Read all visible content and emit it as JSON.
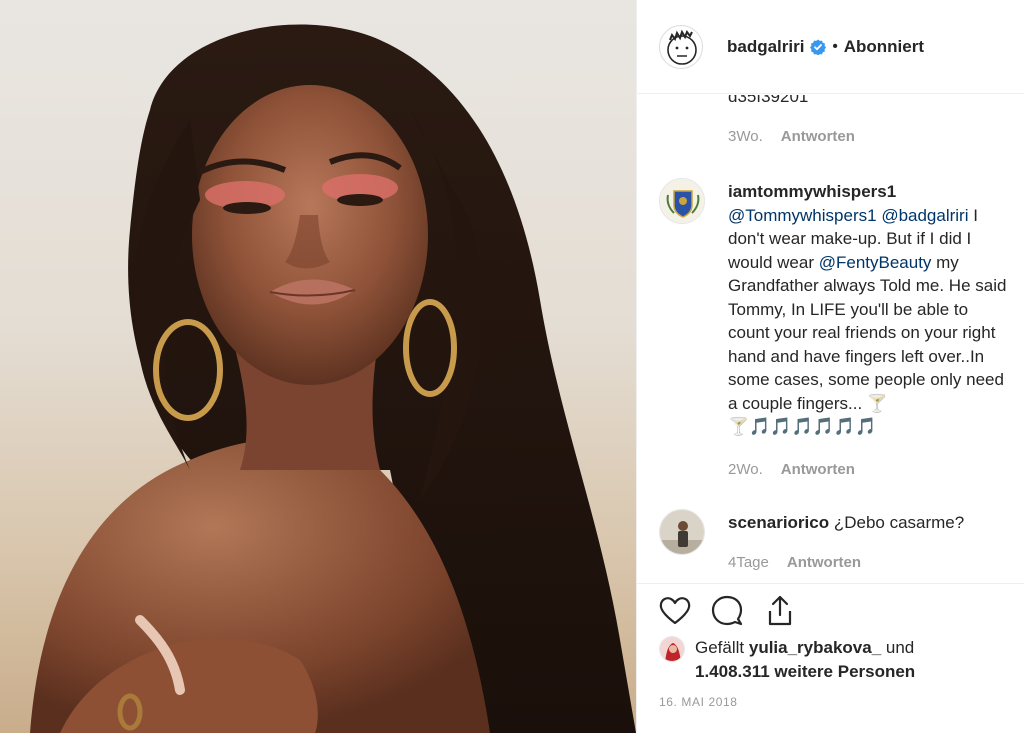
{
  "header": {
    "username": "badgalriri",
    "separator": "•",
    "follow_state": "Abonniert",
    "verified_icon": "verified-badge-icon",
    "verified_color": "#3897f0"
  },
  "comments": {
    "previous_tail": {
      "text": "d35f39201",
      "time": "3Wo.",
      "reply": "Antworten"
    },
    "items": [
      {
        "author": "iamtommywhispers1",
        "mention1": "@Tommywhispers1",
        "mention2": "@badgalriri",
        "text1": " I don't wear make-up. But if I did I would wear ",
        "mention3": "@FentyBeauty",
        "text2": " my Grandfather always Told me. He said Tommy, In LIFE you'll be able to count your real friends on your right hand and have fingers left over..In some cases, some people only need a couple fingers... 🍸",
        "emoji": "🍸🎵🎵🎵🎵🎵🎵",
        "time": "2Wo.",
        "reply": "Antworten"
      },
      {
        "author": "scenariorico",
        "text": " ¿Debo casarme?",
        "time": "4Tage",
        "reply": "Antworten"
      }
    ]
  },
  "actions": {
    "like_icon": "heart-icon",
    "comment_icon": "comment-icon",
    "share_icon": "share-icon"
  },
  "likes": {
    "prefix": "Gefällt ",
    "user": "yulia_rybakova_",
    "middle": " und",
    "count": "1.408.311 weitere Personen"
  },
  "date": "16. MAI 2018",
  "colors": {
    "text": "#262626",
    "muted": "#999999",
    "mention": "#003569",
    "divider": "#efefef"
  }
}
